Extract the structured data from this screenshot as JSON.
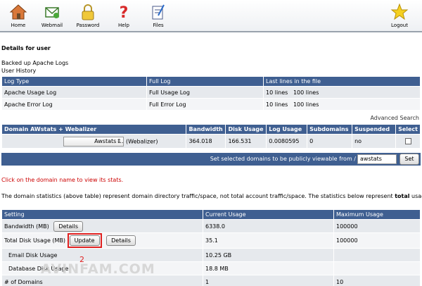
{
  "nav": {
    "items": [
      {
        "label": "Home",
        "icon": "home-icon"
      },
      {
        "label": "Webmail",
        "icon": "mail-icon"
      },
      {
        "label": "Password",
        "icon": "lock-icon"
      },
      {
        "label": "Help",
        "icon": "help-icon"
      },
      {
        "label": "Files",
        "icon": "files-icon"
      }
    ],
    "logout": {
      "label": "Logout",
      "icon": "star-icon"
    }
  },
  "page": {
    "title": "Details for user",
    "links": [
      "Backed up Apache Logs",
      "User History"
    ]
  },
  "logs_table": {
    "headers": [
      "Log Type",
      "Full Log",
      "Last lines in the file"
    ],
    "rows": [
      {
        "type": "Apache Usage Log",
        "full": "Full Usage Log",
        "l10": "10 lines",
        "l100": "100 lines"
      },
      {
        "type": "Apache Error Log",
        "full": "Full Error Log",
        "l10": "10 lines",
        "l100": "100 lines"
      }
    ]
  },
  "advanced_search": "Advanced Search",
  "domain_table": {
    "headers": [
      "Domain AWstats + Webalizer",
      "Bandwidth",
      "Disk Usage",
      "Log Usage",
      "Subdomains",
      "Suspended",
      "Select"
    ],
    "row": {
      "select_value": "Awstats ...",
      "webalizer": "(Webalizer)",
      "bandwidth": "364.018",
      "disk": "166.531",
      "log": "0.0080595",
      "subdomains": "0",
      "suspended": "no"
    }
  },
  "public_bar": {
    "text": "Set selected domains to be publicly viewable from",
    "slash": "/",
    "input_value": "awstats",
    "button": "Set"
  },
  "notes": {
    "red": "Click on the domain name to view its stats.",
    "stats_prefix": "The domain statistics (above table) represent domain directory traffic/space, not total account traffic/space. The statistics below represent ",
    "stats_bold": "total",
    "stats_suffix": " usage."
  },
  "usage_table": {
    "headers": [
      "Setting",
      "Current Usage",
      "Maximum Usage"
    ],
    "rows": [
      {
        "setting": "Bandwidth (MB)",
        "current": "6338.0",
        "max": "100000"
      },
      {
        "setting": "Total Disk Usage (MB)",
        "current": "35.1",
        "max": "100000"
      },
      {
        "setting": "Email Disk Usage",
        "current": "10.25 GB",
        "max": ""
      },
      {
        "setting": "Database Disk Usage",
        "current": "18.8 MB",
        "max": ""
      },
      {
        "setting": "# of Domains",
        "current": "1",
        "max": "10"
      }
    ],
    "details_label": "Details",
    "update_label": "Update"
  },
  "annotation": {
    "marker": "2",
    "watermark": "AVINFAM.COM"
  },
  "colors": {
    "header_blue": "#3f5f91",
    "row_light": "#e6e9ed",
    "highlight_red": "#e02020"
  }
}
